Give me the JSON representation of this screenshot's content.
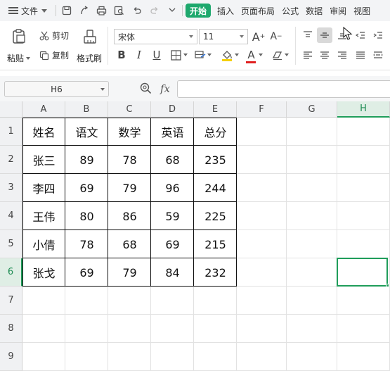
{
  "menubar": {
    "file_label": "文件",
    "tabs": [
      {
        "label": "开始",
        "active": true
      },
      {
        "label": "插入"
      },
      {
        "label": "页面布局"
      },
      {
        "label": "公式"
      },
      {
        "label": "数据"
      },
      {
        "label": "审阅"
      },
      {
        "label": "视图"
      }
    ]
  },
  "ribbon": {
    "paste_label": "粘贴",
    "cut_label": "剪切",
    "copy_label": "复制",
    "format_painter_label": "格式刷",
    "font_name": "宋体",
    "font_size": "11",
    "bold_label": "B",
    "italic_label": "I",
    "underline_label": "U",
    "grow_font_label": "A",
    "shrink_font_label": "A",
    "font_color_label": "A",
    "accent": "#1ea86d",
    "font_color": "#e02020",
    "fill_color": "#f5d000"
  },
  "formula_bar": {
    "cell_ref": "H6",
    "fx_label": "fx",
    "formula": ""
  },
  "sheet": {
    "columns": [
      "A",
      "B",
      "C",
      "D",
      "E",
      "F",
      "G",
      "H"
    ],
    "rows": [
      "1",
      "2",
      "3",
      "4",
      "5",
      "6",
      "7",
      "8",
      "9"
    ],
    "active_column": "H",
    "active_row": "6",
    "table": [
      [
        "姓名",
        "语文",
        "数学",
        "英语",
        "总分"
      ],
      [
        "张三",
        "89",
        "78",
        "68",
        "235"
      ],
      [
        "李四",
        "69",
        "79",
        "96",
        "244"
      ],
      [
        "王伟",
        "80",
        "86",
        "59",
        "225"
      ],
      [
        "小倩",
        "78",
        "68",
        "69",
        "215"
      ],
      [
        "张戈",
        "69",
        "79",
        "84",
        "232"
      ]
    ]
  }
}
